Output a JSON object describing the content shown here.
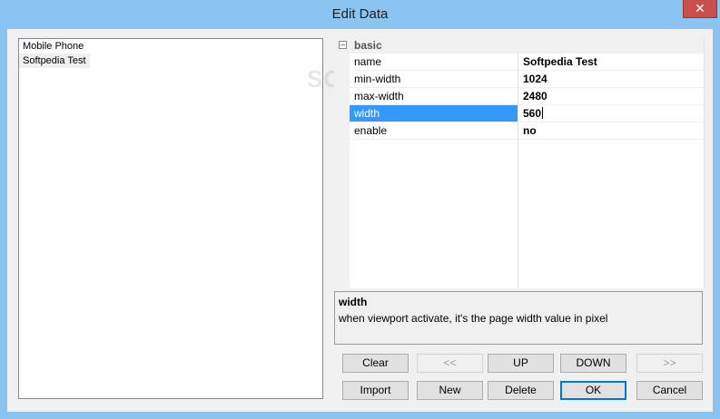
{
  "window": {
    "title": "Edit Data",
    "close_label": "✕"
  },
  "list": {
    "items": [
      "Mobile Phone",
      "Softpedia Test"
    ],
    "selected_index": 1
  },
  "grid": {
    "category": "basic",
    "category_toggle": "−",
    "rows": [
      {
        "name": "name",
        "value": "Softpedia Test"
      },
      {
        "name": "min-width",
        "value": "1024"
      },
      {
        "name": "max-width",
        "value": "2480"
      },
      {
        "name": "width",
        "value": "560"
      },
      {
        "name": "enable",
        "value": "no"
      }
    ],
    "active_row": 3
  },
  "description": {
    "title": "width",
    "text": "when viewport activate, it's the page width value in pixel"
  },
  "buttons": {
    "clear": "Clear",
    "left": "<<",
    "up": "UP",
    "down": "DOWN",
    "right": ">>",
    "import": "Import",
    "new": "New",
    "delete": "Delete",
    "ok": "OK",
    "cancel": "Cancel"
  },
  "watermark": "SOFTPEDIA"
}
